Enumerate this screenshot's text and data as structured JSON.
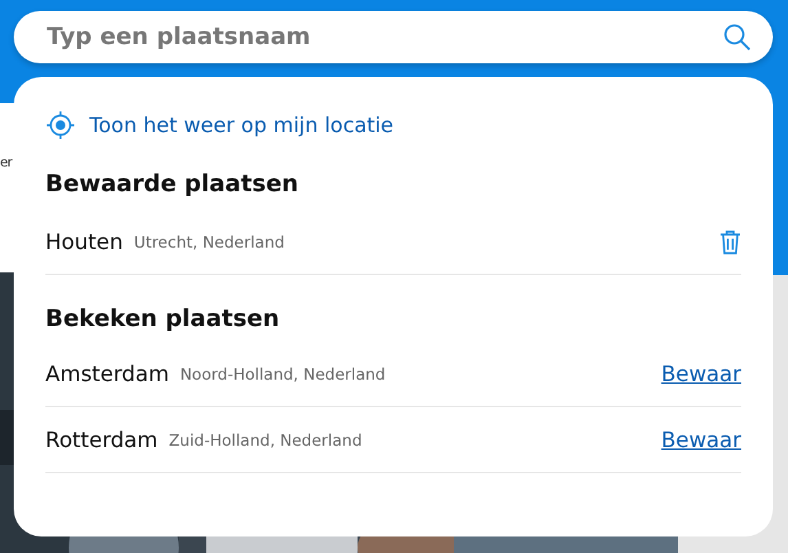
{
  "search": {
    "placeholder": "Typ een plaatsnaam"
  },
  "background_text": "er",
  "location_link": "Toon het weer op mijn locatie",
  "saved": {
    "heading": "Bewaarde plaatsen",
    "places": [
      {
        "name": "Houten",
        "region": "Utrecht, Nederland",
        "kind": "saved"
      }
    ]
  },
  "viewed": {
    "heading": "Bekeken plaatsen",
    "places": [
      {
        "name": "Amsterdam",
        "region": "Noord-Holland, Nederland",
        "kind": "viewed",
        "action": "Bewaar"
      },
      {
        "name": "Rotterdam",
        "region": "Zuid-Holland, Nederland",
        "kind": "viewed",
        "action": "Bewaar"
      }
    ]
  }
}
